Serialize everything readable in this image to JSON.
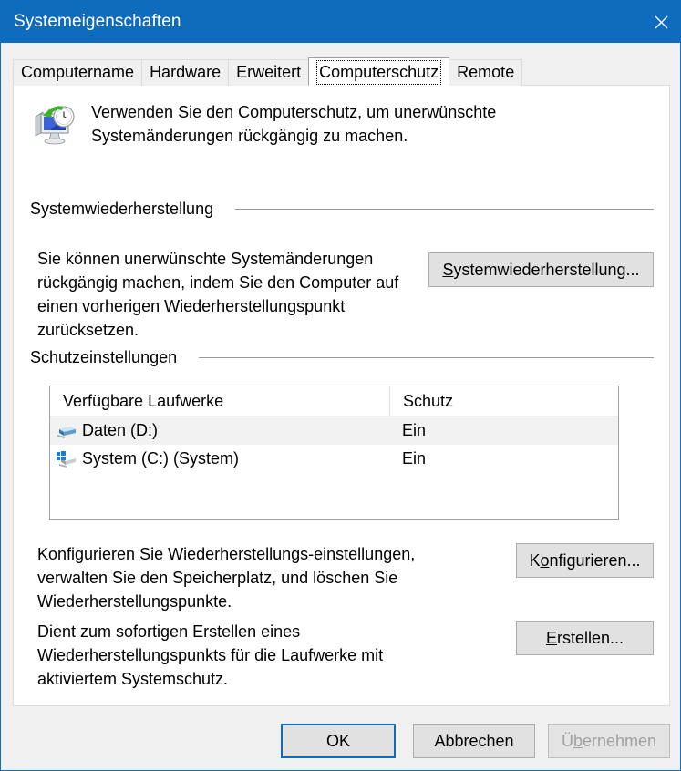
{
  "window": {
    "title": "Systemeigenschaften",
    "close_label": "✕",
    "titlebar_color": "#0f6cbd"
  },
  "tabs": [
    {
      "label": "Computername",
      "active": false
    },
    {
      "label": "Hardware",
      "active": false
    },
    {
      "label": "Erweitert",
      "active": false
    },
    {
      "label": "Computerschutz",
      "active": true
    },
    {
      "label": "Remote",
      "active": false
    }
  ],
  "header": {
    "icon": "system-restore-icon",
    "text": "Verwenden Sie den Computerschutz, um unerwünschte Systemänderungen rückgängig zu machen."
  },
  "restore_section": {
    "group_label": "Systemwiederherstellung",
    "description": "Sie können unerwünschte Systemänderungen rückgängig machen, indem Sie den Computer auf einen vorherigen Wiederherstellungspunkt zurücksetzen.",
    "button": {
      "accel": "S",
      "rest": "ystemwiederherstellung..."
    }
  },
  "protection_section": {
    "group_label": "Schutzeinstellungen",
    "columns": [
      "Verfügbare Laufwerke",
      "Schutz"
    ],
    "rows": [
      {
        "icon": "data-drive-icon",
        "drive": "Daten (D:)",
        "protection": "Ein",
        "selected": true
      },
      {
        "icon": "system-drive-icon",
        "drive": "System (C:) (System)",
        "protection": "Ein",
        "selected": false
      }
    ],
    "configure_description": "Konfigurieren Sie Wiederherstellungs-einstellungen, verwalten Sie den Speicherplatz, und löschen Sie Wiederherstellungspunkte.",
    "configure_button": {
      "pre": "K",
      "accel": "o",
      "rest": "nfigurieren..."
    },
    "create_description": "Dient zum sofortigen Erstellen eines Wiederherstellungspunkts für die Laufwerke mit aktiviertem Systemschutz.",
    "create_button": {
      "accel": "E",
      "rest": "rstellen..."
    }
  },
  "footer": {
    "ok": "OK",
    "cancel": "Abbrechen",
    "apply": {
      "pre": "Ü",
      "accel": "b",
      "rest": "ernehmen"
    }
  }
}
